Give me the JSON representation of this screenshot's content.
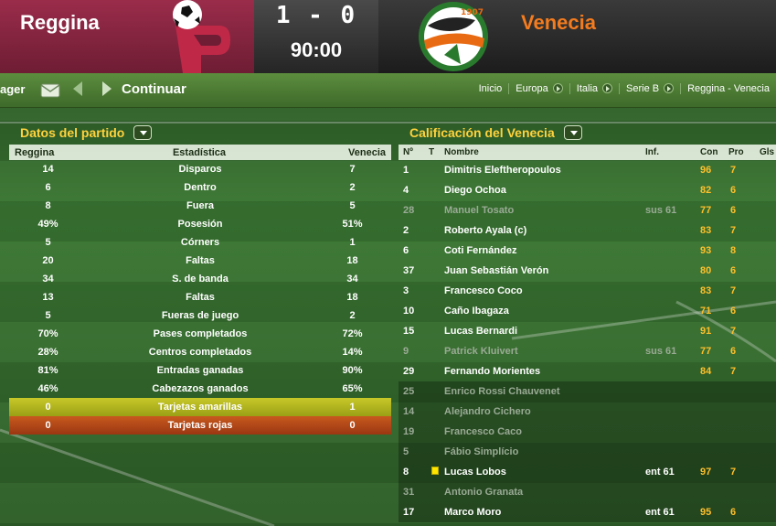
{
  "header": {
    "home_team": "Reggina",
    "away_team": "Venecia",
    "score": "1 - 0",
    "clock": "90:00",
    "away_crest_year": "1907"
  },
  "toolbar": {
    "left_cut_label": "ager",
    "continue_label": "Continuar",
    "breadcrumbs": [
      "Inicio",
      "Europa",
      "Italia",
      "Serie B",
      "Reggina - Venecia"
    ]
  },
  "left_panel": {
    "title": "Datos del partido",
    "headers": {
      "home": "Reggina",
      "stat": "Estadística",
      "away": "Venecia"
    },
    "rows": [
      {
        "home": "14",
        "stat": "Disparos",
        "away": "7"
      },
      {
        "home": "6",
        "stat": "Dentro",
        "away": "2"
      },
      {
        "home": "8",
        "stat": "Fuera",
        "away": "5"
      },
      {
        "home": "49%",
        "stat": "Posesión",
        "away": "51%"
      },
      {
        "home": "5",
        "stat": "Córners",
        "away": "1"
      },
      {
        "home": "20",
        "stat": "Faltas",
        "away": "18"
      },
      {
        "home": "34",
        "stat": "S. de banda",
        "away": "34"
      },
      {
        "home": "13",
        "stat": "Faltas",
        "away": "18"
      },
      {
        "home": "5",
        "stat": "Fueras de juego",
        "away": "2"
      },
      {
        "home": "70%",
        "stat": "Pases completados",
        "away": "72%"
      },
      {
        "home": "28%",
        "stat": "Centros completados",
        "away": "14%"
      },
      {
        "home": "81%",
        "stat": "Entradas ganadas",
        "away": "90%"
      },
      {
        "home": "46%",
        "stat": "Cabezazos ganados",
        "away": "65%"
      },
      {
        "home": "0",
        "stat": "Tarjetas amarillas",
        "away": "1"
      },
      {
        "home": "0",
        "stat": "Tarjetas rojas",
        "away": "0"
      }
    ]
  },
  "right_panel": {
    "title": "Calificación del Venecia",
    "headers": {
      "num": "Nº",
      "t": "T",
      "name": "Nombre",
      "inf": "Inf.",
      "con": "Con",
      "pro": "Pro",
      "gls": "Gls"
    },
    "rows": [
      {
        "num": "1",
        "name": "Dimitris Eleftheropoulos",
        "inf": "",
        "con": "96",
        "pro": "7"
      },
      {
        "num": "4",
        "name": "Diego Ochoa",
        "inf": "",
        "con": "82",
        "pro": "6"
      },
      {
        "num": "28",
        "name": "Manuel Tosato",
        "inf": "sus 61",
        "con": "77",
        "pro": "6"
      },
      {
        "num": "2",
        "name": "Roberto Ayala (c)",
        "inf": "",
        "con": "83",
        "pro": "7"
      },
      {
        "num": "6",
        "name": "Coti Fernández",
        "inf": "",
        "con": "93",
        "pro": "8"
      },
      {
        "num": "37",
        "name": "Juan Sebastián Verón",
        "inf": "",
        "con": "80",
        "pro": "6"
      },
      {
        "num": "3",
        "name": "Francesco Coco",
        "inf": "",
        "con": "83",
        "pro": "7"
      },
      {
        "num": "10",
        "name": "Caño Ibagaza",
        "inf": "",
        "con": "71",
        "pro": "6"
      },
      {
        "num": "15",
        "name": "Lucas Bernardi",
        "inf": "",
        "con": "91",
        "pro": "7"
      },
      {
        "num": "9",
        "name": "Patrick Kluivert",
        "inf": "sus 61",
        "con": "77",
        "pro": "6"
      },
      {
        "num": "29",
        "name": "Fernando Morientes",
        "inf": "",
        "con": "84",
        "pro": "7"
      },
      {
        "num": "25",
        "name": "Enrico Rossi Chauvenet",
        "inf": "",
        "con": "",
        "pro": ""
      },
      {
        "num": "14",
        "name": "Alejandro Cichero",
        "inf": "",
        "con": "",
        "pro": ""
      },
      {
        "num": "19",
        "name": "Francesco Caco",
        "inf": "",
        "con": "",
        "pro": ""
      },
      {
        "num": "5",
        "name": "Fábio Simplício",
        "inf": "",
        "con": "",
        "pro": ""
      },
      {
        "num": "8",
        "name": "Lucas Lobos",
        "inf": "ent 61",
        "con": "97",
        "pro": "7"
      },
      {
        "num": "31",
        "name": "Antonio Granata",
        "inf": "",
        "con": "",
        "pro": ""
      },
      {
        "num": "17",
        "name": "Marco Moro",
        "inf": "ent 61",
        "con": "95",
        "pro": "6"
      }
    ]
  }
}
